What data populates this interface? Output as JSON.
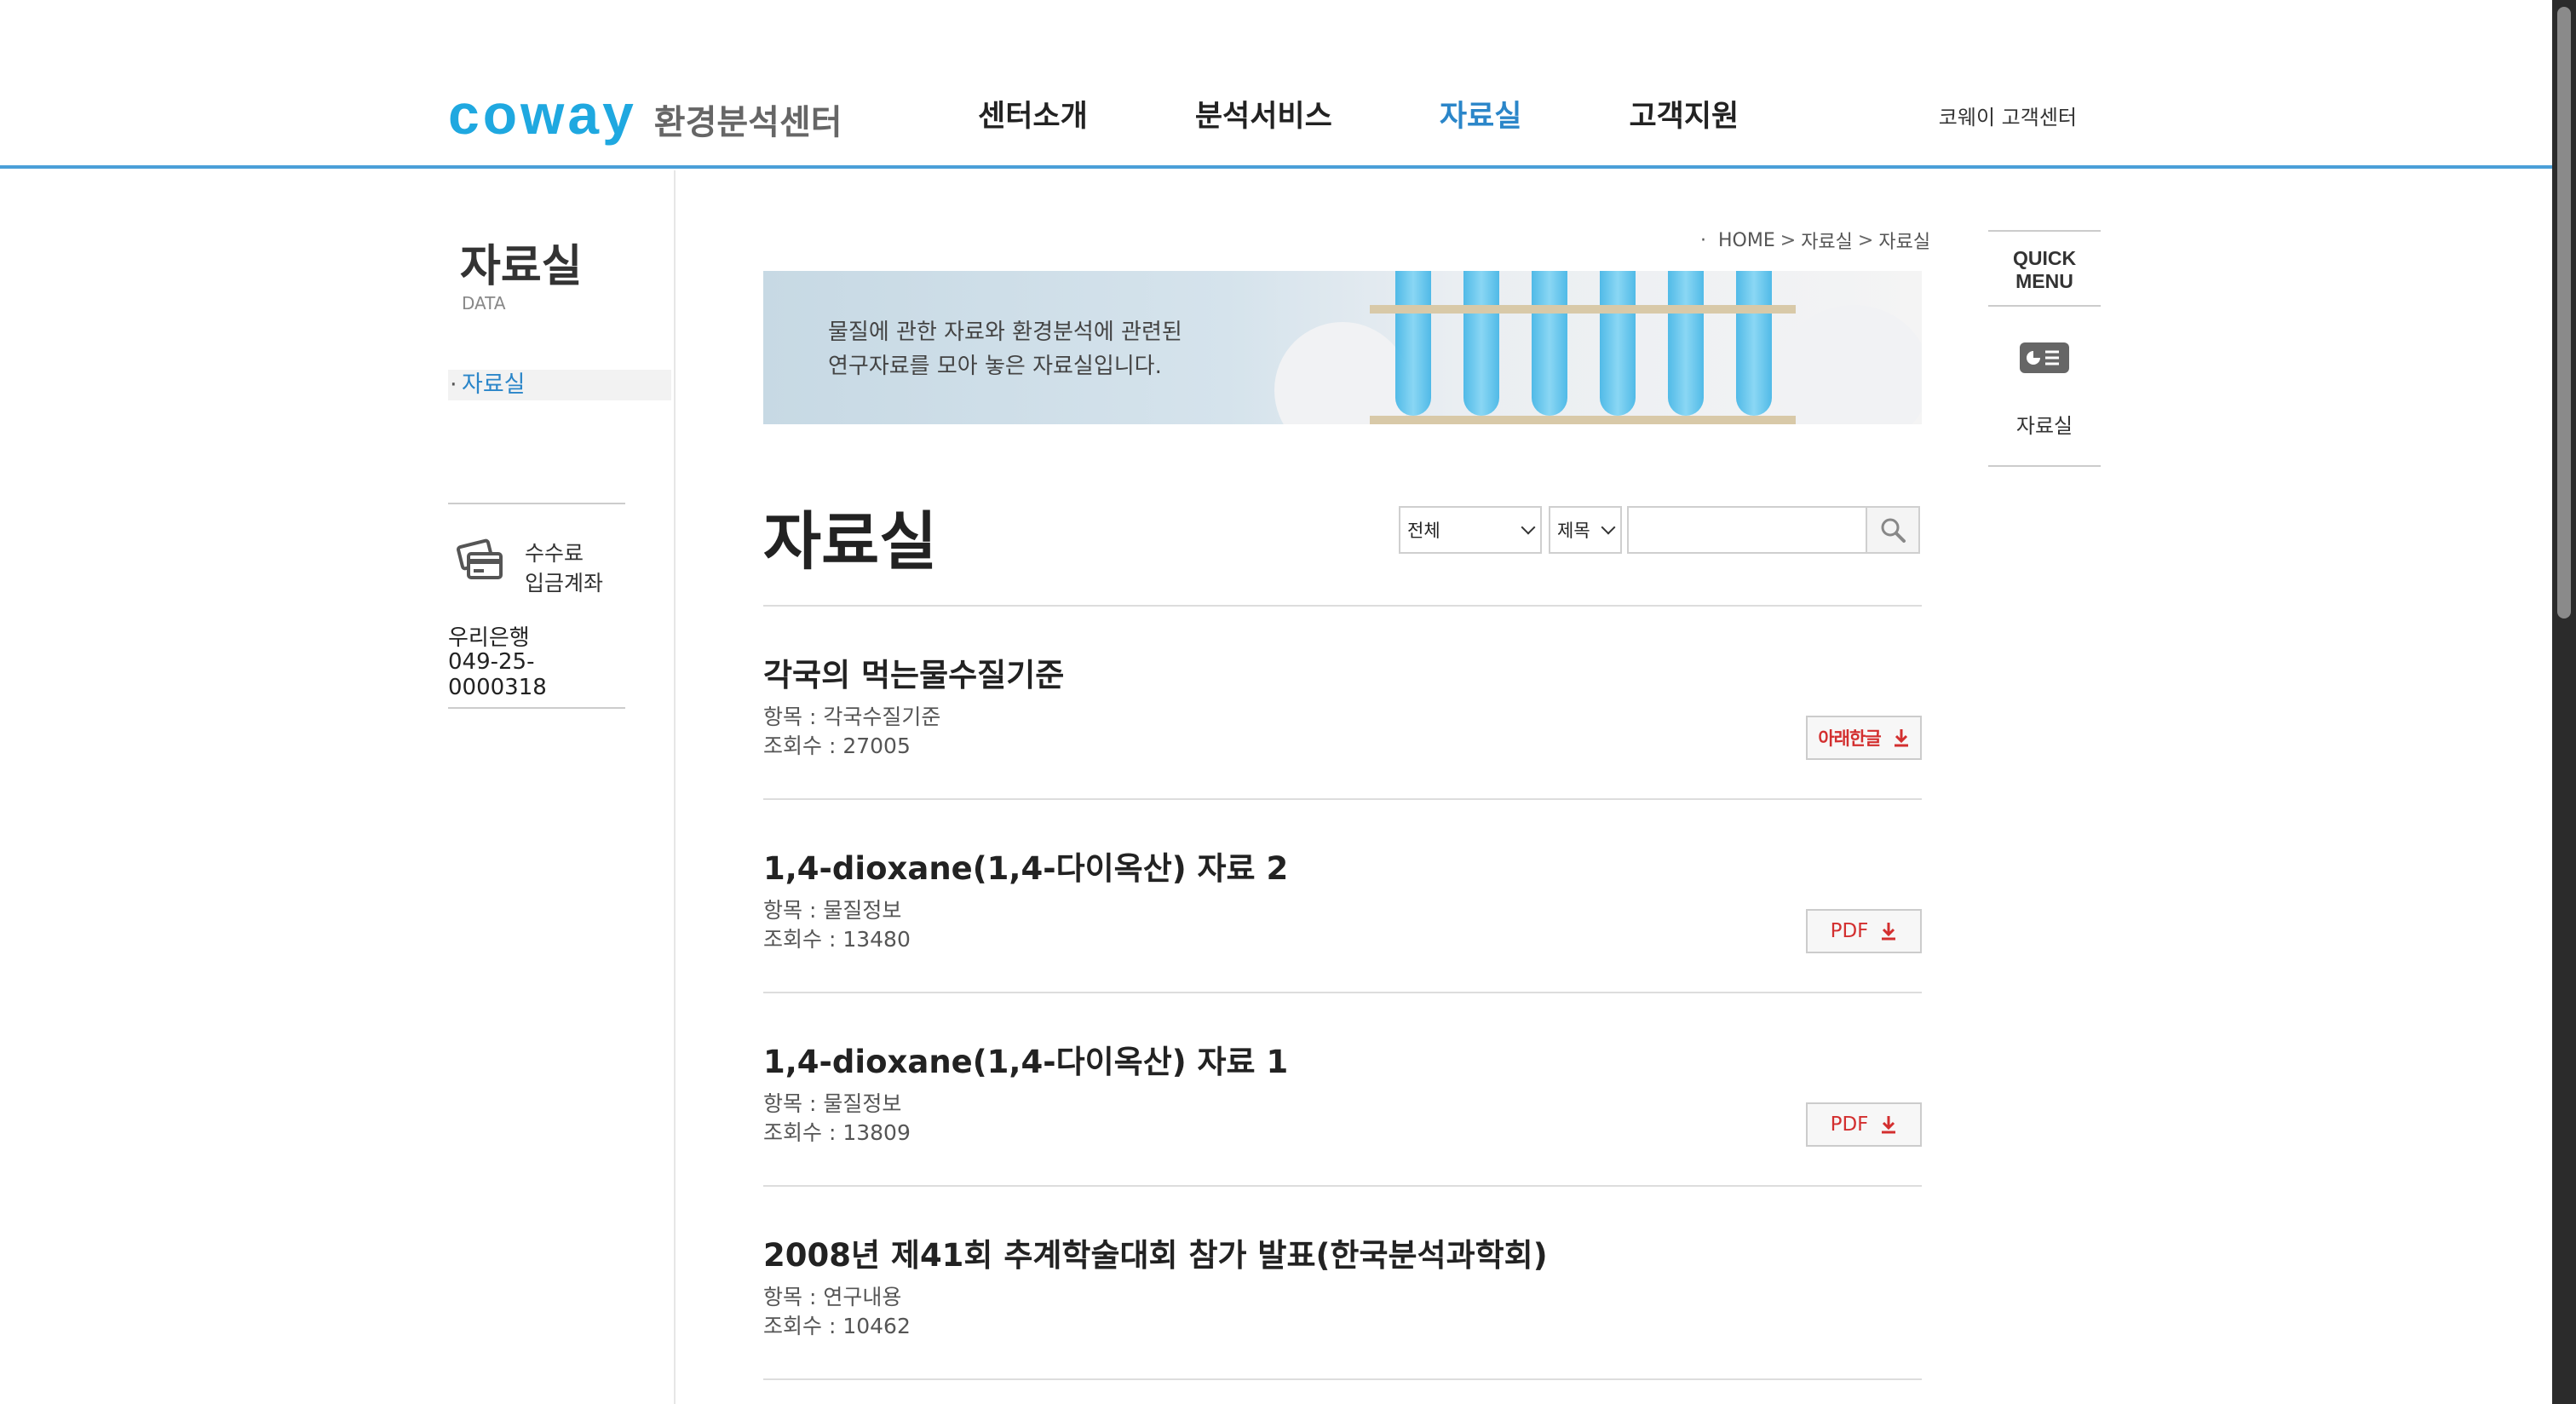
{
  "header": {
    "logo_mark": "coway",
    "logo_sub": "환경분석센터",
    "nav": [
      {
        "label": "센터소개"
      },
      {
        "label": "분석서비스"
      },
      {
        "label": "자료실"
      },
      {
        "label": "고객지원"
      }
    ],
    "util_link": "코웨이 고객센터",
    "accent_color": "#2b86c9"
  },
  "sidebar": {
    "title": "자료실",
    "subtitle": "DATA",
    "item": "자료실",
    "bank_label_1": "수수료",
    "bank_label_2": "입금계좌",
    "bank_name": "우리은행",
    "account_number": "049-25-0000318"
  },
  "breadcrumb": {
    "home": "HOME",
    "level1": "자료실",
    "level2": "자료실"
  },
  "banner": {
    "line1": "물질에 관한 자료와 환경분석에 관련된",
    "line2": "연구자료를 모아 놓은 자료실입니다."
  },
  "page_title": "자료실",
  "search": {
    "category_value": "전체",
    "field_value": "제목",
    "query": ""
  },
  "list": [
    {
      "title": "각국의 먹는물수질기준",
      "category": "항목 : 각국수질기준",
      "views": "조회수 : 27005",
      "download": "아래한글"
    },
    {
      "title": "1,4-dioxane(1,4-다이옥산) 자료 2",
      "category": "항목 : 물질정보",
      "views": "조회수 : 13480",
      "download": "PDF"
    },
    {
      "title": "1,4-dioxane(1,4-다이옥산) 자료 1",
      "category": "항목 : 물질정보",
      "views": "조회수 : 13809",
      "download": "PDF"
    },
    {
      "title": "2008년 제41회 추계학술대회 참가 발표(한국분석과학회)",
      "category": "항목 : 연구내용",
      "views": "조회수 : 10462"
    }
  ],
  "quick_menu": {
    "head_1": "QUICK",
    "head_2": "MENU",
    "item": "자료실"
  }
}
